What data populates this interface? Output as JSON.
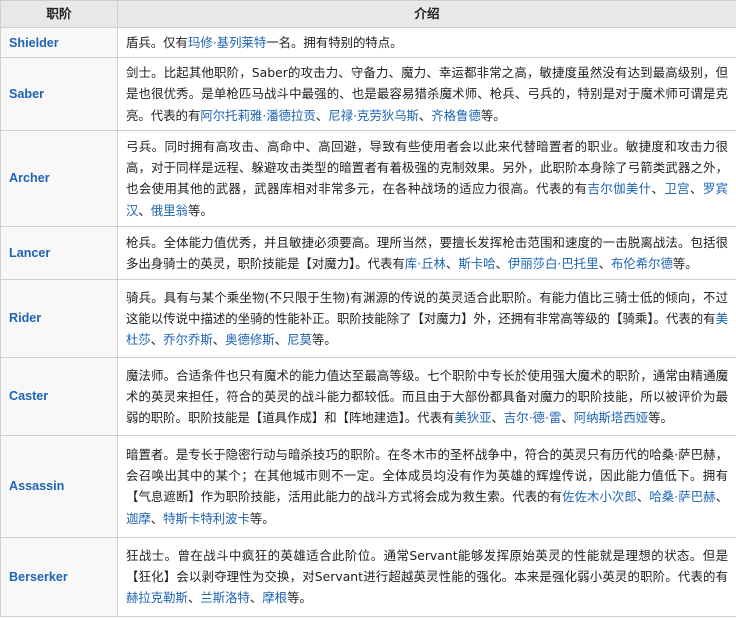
{
  "table": {
    "headers": [
      "职阶",
      "介绍"
    ],
    "rows": [
      {
        "id": "shielder",
        "name": "Shielder",
        "segments": [
          {
            "t": "盾兵。仅有"
          },
          {
            "t": "玛修·基列莱特",
            "link": true
          },
          {
            "t": "一名。拥有特别的特点。"
          }
        ]
      },
      {
        "id": "saber",
        "name": "Saber",
        "segments": [
          {
            "t": "剑士。比起其他职阶，Saber的攻击力、守备力、魔力、幸运都非常之高，敏捷度虽然没有达到最高级别，但是也很优秀。是单枪匹马战斗中最强的、也是最容易猎杀魔术师、枪兵、弓兵的，特别是对于魔术师可谓是克亮。代表的有"
          },
          {
            "t": "阿尔托莉雅·潘德拉贡",
            "link": true
          },
          {
            "t": "、"
          },
          {
            "t": "尼禄·克劳狄乌斯",
            "link": true
          },
          {
            "t": "、"
          },
          {
            "t": "齐格鲁德",
            "link": true
          },
          {
            "t": "等。"
          }
        ]
      },
      {
        "id": "archer",
        "name": "Archer",
        "segments": [
          {
            "t": "弓兵。同时拥有高攻击、高命中、高回避，导致有些使用者会以此来代替暗置者的职业。敏捷度和攻击力很高，对于同样是远程、躲避攻击类型的暗置者有着极强的克制效果。另外，此职阶本身除了弓箭类武器之外，也会使用其他的武器，武器库相对非常多元，在各种战场的适应力很高。代表的有"
          },
          {
            "t": "吉尔伽美什",
            "link": true
          },
          {
            "t": "、"
          },
          {
            "t": "卫宫",
            "link": true
          },
          {
            "t": "、"
          },
          {
            "t": "罗宾汉",
            "link": true
          },
          {
            "t": "、"
          },
          {
            "t": "俄里翁",
            "link": true
          },
          {
            "t": "等。"
          }
        ]
      },
      {
        "id": "lancer",
        "name": "Lancer",
        "segments": [
          {
            "t": "枪兵。全体能力值优秀，并且敏捷必须要高。理所当然，要擅长发挥枪击范围和速度的一击脱离战法。包括很多出身骑士的英灵，职阶技能是【对魔力】。代表有"
          },
          {
            "t": "库·丘林",
            "link": true
          },
          {
            "t": "、"
          },
          {
            "t": "斯卡哈",
            "link": true
          },
          {
            "t": "、"
          },
          {
            "t": "伊丽莎白·巴托里",
            "link": true
          },
          {
            "t": "、"
          },
          {
            "t": "布伦希尔德",
            "link": true
          },
          {
            "t": "等。"
          }
        ]
      },
      {
        "id": "rider",
        "name": "Rider",
        "segments": [
          {
            "t": "骑兵。具有与某个乘坐物(不只限于生物)有渊源的传说的英灵适合此职阶。有能力值比三骑士低的倾向，不过这能以传说中描述的坐骑的性能补正。职阶技能除了【对魔力】外，还拥有非常高等级的【骑乘】。代表的有"
          },
          {
            "t": "美杜莎",
            "link": true
          },
          {
            "t": "、"
          },
          {
            "t": "乔尔乔斯",
            "link": true
          },
          {
            "t": "、"
          },
          {
            "t": "奥德修斯",
            "link": true
          },
          {
            "t": "、"
          },
          {
            "t": "尼莫",
            "link": true
          },
          {
            "t": "等。"
          }
        ]
      },
      {
        "id": "caster",
        "name": "Caster",
        "segments": [
          {
            "t": "魔法师。合适条件也只有魔术的能力值达至最高等级。七个职阶中专长於使用强大魔术的职阶，通常由精通魔术的英灵来担任，符合的英灵的战斗能力都较低。而且由于大部份都具备对魔力的职阶技能，所以被评价为最弱的职阶。职阶技能是【道具作成】和【阵地建造】。代表有"
          },
          {
            "t": "美狄亚",
            "link": true
          },
          {
            "t": "、"
          },
          {
            "t": "吉尔·德·雷",
            "link": true
          },
          {
            "t": "、"
          },
          {
            "t": "阿纳斯塔西娅",
            "link": true
          },
          {
            "t": "等。"
          }
        ]
      },
      {
        "id": "assassin",
        "name": "Assassin",
        "segments": [
          {
            "t": "暗置者。是专长于隐密行动与暗杀技巧的职阶。在冬木市的圣杯战争中，符合的英灵只有历代的哈桑·萨巴赫，会召唤出其中的某个；在其他城市则不一定。全体成员均没有作为英雄的辉煌传说，因此能力值低下。拥有【气息遮断】作为职阶技能，活用此能力的战斗方式将会成为救生索。代表的有"
          },
          {
            "t": "佐佐木小次郎",
            "link": true
          },
          {
            "t": "、"
          },
          {
            "t": "哈桑·萨巴赫",
            "link": true
          },
          {
            "t": "、"
          },
          {
            "t": "迦摩",
            "link": true
          },
          {
            "t": "、"
          },
          {
            "t": "特斯卡特利波卡",
            "link": true
          },
          {
            "t": "等。"
          }
        ]
      },
      {
        "id": "berserker",
        "name": "Berserker",
        "segments": [
          {
            "t": "狂战士。曾在战斗中疯狂的英雄适合此阶位。通常Servant能够发挥原始英灵的性能就是理想的状态。但是【狂化】会以剥夺理性为交换，对Servant进行超越英灵性能的强化。本来是强化弱小英灵的职阶。代表的有"
          },
          {
            "t": "赫拉克勒斯",
            "link": true
          },
          {
            "t": "、"
          },
          {
            "t": "兰斯洛特",
            "link": true
          },
          {
            "t": "、"
          },
          {
            "t": "摩根",
            "link": true
          },
          {
            "t": "等。"
          }
        ]
      }
    ]
  }
}
